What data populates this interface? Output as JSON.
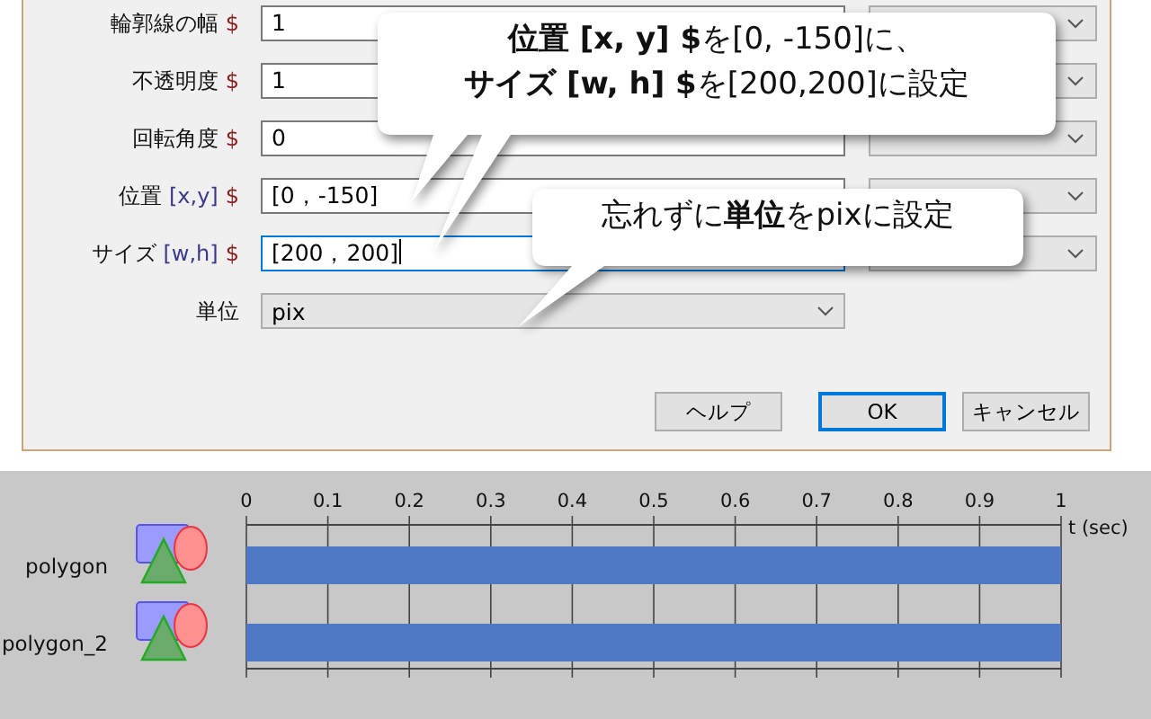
{
  "dialog": {
    "fields": [
      {
        "label": "輪郭線の幅",
        "sign": "$",
        "kind": "text",
        "value": "1",
        "focused": false,
        "mode_dropdown": true
      },
      {
        "label": "不透明度",
        "sign": "$",
        "kind": "text",
        "value": "1",
        "focused": false,
        "mode_dropdown": true
      },
      {
        "label": "回転角度",
        "sign": "$",
        "kind": "text",
        "value": "0",
        "focused": false,
        "mode_dropdown": true
      },
      {
        "label": "位置",
        "param": "[x,y]",
        "sign": "$",
        "kind": "text",
        "value": "[0，-150]",
        "focused": false,
        "mode_dropdown": true
      },
      {
        "label": "サイズ",
        "param": "[w,h]",
        "sign": "$",
        "kind": "text",
        "value": "[200，200]",
        "focused": true,
        "mode_dropdown": true
      },
      {
        "label": "単位",
        "kind": "select",
        "value": "pix",
        "focused": false,
        "mode_dropdown": false
      }
    ],
    "buttons": [
      {
        "label": "ヘルプ",
        "default": false
      },
      {
        "label": "OK",
        "default": true
      },
      {
        "label": "キャンセル",
        "default": false
      }
    ],
    "callouts": [
      {
        "lines": [
          "**位置 [x, y] $**を[0, -150]に、",
          "**サイズ [w, h] $**を[200,200]に設定"
        ]
      },
      {
        "lines": [
          "忘れずに**単位**をpixに設定"
        ]
      }
    ]
  },
  "timeline": {
    "axis_label": "t (sec)",
    "chart_data": {
      "type": "bar",
      "orientation": "horizontal",
      "categories": [
        "polygon",
        "polygon_2"
      ],
      "values": [
        1,
        1
      ],
      "xlim": [
        0,
        1
      ],
      "xticks": [
        0,
        0.1,
        0.2,
        0.3,
        0.4,
        0.5,
        0.6,
        0.7,
        0.8,
        0.9,
        1
      ],
      "grid": true
    }
  }
}
